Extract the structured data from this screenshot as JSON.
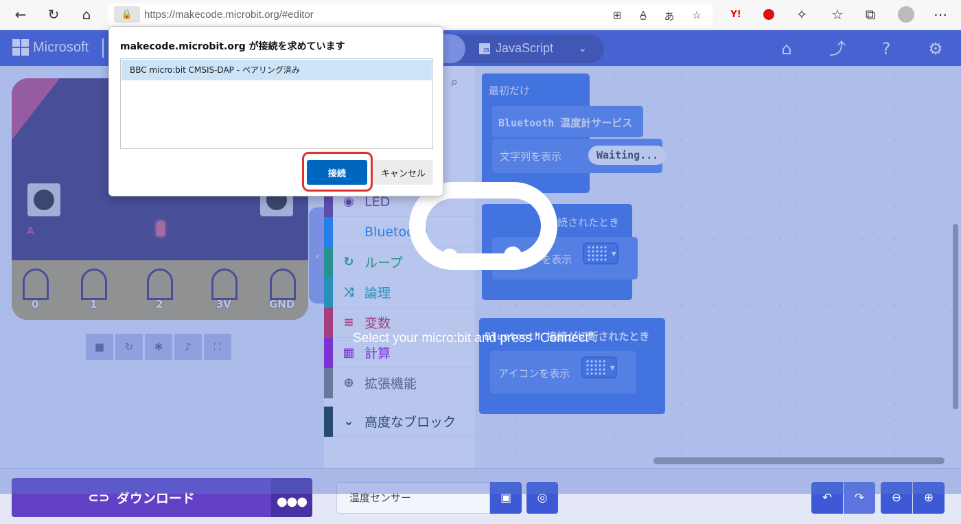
{
  "browser": {
    "url": "https://makecode.microbit.org/#editor",
    "reader_icon": "A͇",
    "translate_icon": "あ",
    "ext_yahoo": "Y!"
  },
  "header": {
    "brand": "Microsoft",
    "js_badge": "JS",
    "js_tab_label": "JavaScript"
  },
  "simulator": {
    "button_a_label": "A",
    "pins": [
      "0",
      "1",
      "2",
      "3V",
      "GND"
    ]
  },
  "toolbox": {
    "categories": [
      {
        "label": "LED",
        "color": "#5c2d91"
      },
      {
        "label": "Bluetooth",
        "color": "#0082fb"
      },
      {
        "label": "ループ",
        "color": "#00a65c"
      },
      {
        "label": "論理",
        "color": "#00a4a6"
      },
      {
        "label": "変数",
        "color": "#dc143c"
      },
      {
        "label": "計算",
        "color": "#9400d3"
      },
      {
        "label": "拡張機能",
        "color": "#757575"
      },
      {
        "label": "高度なブロック",
        "color": "#00272b"
      }
    ]
  },
  "workspace": {
    "on_start": "最初だけ",
    "bt_temp_service": "Bluetooth 温度計サービス",
    "show_string": "文字列を表示",
    "waiting_text": "Waiting...",
    "on_connected": "接続されたとき",
    "show_icon_1": "アイコンを表示",
    "on_disconnected": "Bluetooth 接続が切断されたとき",
    "show_icon_2": "アイコンを表示"
  },
  "footer": {
    "download_label": "ダウンロード",
    "more_label": "●●●",
    "project_name": "温度センサー"
  },
  "overlay": {
    "message": "Select your micro:bit and press \"Connect\"."
  },
  "dialog": {
    "title": "makecode.microbit.org が接続を求めています",
    "device": "BBC micro:bit CMSIS-DAP - ペアリング済み",
    "connect_label": "接続",
    "cancel_label": "キャンセル"
  }
}
